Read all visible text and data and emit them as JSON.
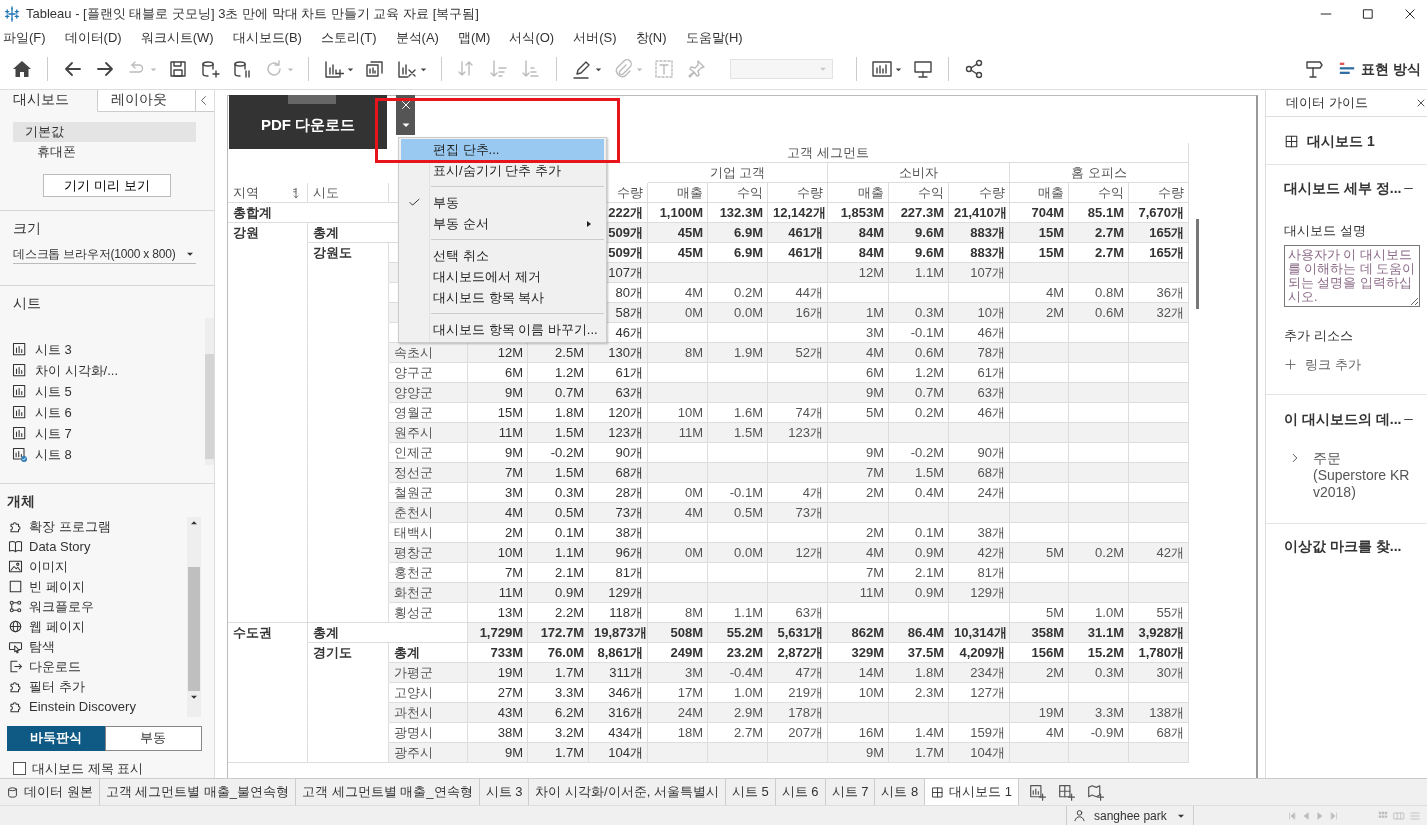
{
  "window": {
    "title": "Tableau - [플랜잇 태블로 굿모닝] 3초 만에 막대 차트 만들기 교육 자료 [복구됨]"
  },
  "menu_bar": [
    "파일(F)",
    "데이터(D)",
    "워크시트(W)",
    "대시보드(B)",
    "스토리(T)",
    "분석(A)",
    "맵(M)",
    "서식(O)",
    "서버(S)",
    "창(N)",
    "도움말(H)"
  ],
  "toolbar": [
    {
      "kind": "home",
      "disabled": false,
      "dropdown": false
    },
    {
      "kind": "separator"
    },
    {
      "kind": "back",
      "disabled": false,
      "dropdown": false
    },
    {
      "kind": "forward",
      "disabled": false,
      "dropdown": false
    },
    {
      "kind": "redo",
      "disabled": true,
      "dropdown": true
    },
    {
      "kind": "save",
      "disabled": false,
      "dropdown": false
    },
    {
      "kind": "db_add",
      "disabled": false,
      "dropdown": false
    },
    {
      "kind": "db_pause",
      "disabled": false,
      "dropdown": false
    },
    {
      "kind": "refresh",
      "disabled": true,
      "dropdown": true
    },
    {
      "kind": "separator"
    },
    {
      "kind": "chart_add",
      "disabled": false,
      "dropdown": true
    },
    {
      "kind": "chart_copy",
      "disabled": false,
      "dropdown": false
    },
    {
      "kind": "chart_clear",
      "disabled": false,
      "dropdown": true
    },
    {
      "kind": "separator"
    },
    {
      "kind": "swap",
      "disabled": true,
      "dropdown": false
    },
    {
      "kind": "sort_asc",
      "disabled": true,
      "dropdown": false
    },
    {
      "kind": "sort_desc",
      "disabled": true,
      "dropdown": false
    },
    {
      "kind": "separator"
    },
    {
      "kind": "pen",
      "disabled": false,
      "dropdown": true
    },
    {
      "kind": "paperclip",
      "disabled": true,
      "dropdown": true
    },
    {
      "kind": "textbox",
      "disabled": true,
      "dropdown": false
    },
    {
      "kind": "pin",
      "disabled": true,
      "dropdown": false
    },
    {
      "kind": "select",
      "disabled": true,
      "dropdown": true
    },
    {
      "kind": "separator"
    },
    {
      "kind": "show_me",
      "disabled": false,
      "dropdown": true
    },
    {
      "kind": "present",
      "disabled": false,
      "dropdown": false
    },
    {
      "kind": "separator"
    },
    {
      "kind": "share",
      "disabled": false,
      "dropdown": false
    }
  ],
  "toolbar_right": {
    "presentation_label": "표현 방식"
  },
  "left_panel": {
    "tabs": [
      {
        "label": "대시보드",
        "selected": true
      },
      {
        "label": "레이아웃",
        "selected": false
      }
    ],
    "devices": [
      {
        "label": "기본값",
        "selected": true
      },
      {
        "label": "휴대폰",
        "selected": false
      }
    ],
    "preview_button": "기기 미리 보기",
    "size_title": "크기",
    "size_value": "데스크톱 브라우저(1000 x 800)",
    "sheets_title": "시트",
    "sheets": [
      {
        "label": "시트 3",
        "used": false
      },
      {
        "label": "차이 시각화/...",
        "used": false
      },
      {
        "label": "시트 5",
        "used": false
      },
      {
        "label": "시트 6",
        "used": false
      },
      {
        "label": "시트 7",
        "used": false
      },
      {
        "label": "시트 8",
        "used": true
      }
    ],
    "objects_title": "개체",
    "objects": [
      {
        "kind": "extension",
        "label": "확장 프로그램"
      },
      {
        "kind": "story",
        "label": "Data Story"
      },
      {
        "kind": "image",
        "label": "이미지"
      },
      {
        "kind": "blank",
        "label": "빈 페이지"
      },
      {
        "kind": "workflow",
        "label": "워크플로우"
      },
      {
        "kind": "web",
        "label": "웹 페이지"
      },
      {
        "kind": "navigation",
        "label": "탐색"
      },
      {
        "kind": "download",
        "label": "다운로드"
      },
      {
        "kind": "filter",
        "label": "필터 추가"
      },
      {
        "kind": "einstein",
        "label": "Einstein Discovery"
      }
    ],
    "layout_modes": [
      {
        "label": "바둑판식",
        "selected": true
      },
      {
        "label": "부동",
        "selected": false
      }
    ],
    "show_title": {
      "label": "대시보드 제목 표시",
      "checked": false
    }
  },
  "dashboard": {
    "pdf_object": {
      "label": "PDF 다운로드"
    },
    "table": {
      "title": "고객 세그먼트",
      "segments": [
        "기업 고객",
        "소비자",
        "홈 오피스"
      ],
      "dimension_columns": [
        {
          "label": "지역",
          "sorted": true
        },
        {
          "label": "시도",
          "sorted": false
        }
      ],
      "measure_columns": [
        "수량",
        "매출",
        "수익",
        "수량",
        "매출",
        "수익",
        "수량",
        "매출",
        "수익",
        "수량"
      ],
      "rows": [
        {
          "kind": "grand_total",
          "region": "총합계",
          "values": {
            "column_6": "222개",
            "column_7": "1,100M",
            "column_8": "132.3M",
            "column_9": "12,142개",
            "column_10": "1,853M",
            "column_11": "227.3M",
            "column_12": "21,410개",
            "column_13": "704M",
            "column_14": "85.1M",
            "column_15": "7,670개"
          }
        },
        {
          "kind": "region_total",
          "region": "강원",
          "sido": "총계",
          "values": {
            "column_6": "509개",
            "column_7": "45M",
            "column_8": "6.9M",
            "column_9": "461개",
            "column_10": "84M",
            "column_11": "9.6M",
            "column_12": "883개",
            "column_13": "15M",
            "column_14": "2.7M",
            "column_15": "165개"
          }
        },
        {
          "kind": "sido_total",
          "sido": "강원도",
          "values": {
            "column_6": "509개",
            "column_7": "45M",
            "column_8": "6.9M",
            "column_9": "461개",
            "column_10": "84M",
            "column_11": "9.6M",
            "column_12": "883개",
            "column_13": "15M",
            "column_14": "2.7M",
            "column_15": "165개"
          }
        },
        {
          "kind": "detail",
          "values": {
            "column_6": "107개",
            "column_10": "12M",
            "column_11": "1.1M",
            "column_12": "107개"
          }
        },
        {
          "kind": "detail",
          "values": {
            "column_6": "80개",
            "column_7": "4M",
            "column_8": "0.2M",
            "column_9": "44개",
            "column_13": "4M",
            "column_14": "0.8M",
            "column_15": "36개"
          }
        },
        {
          "kind": "detail",
          "values": {
            "column_6": "58개",
            "column_7": "0M",
            "column_8": "0.0M",
            "column_9": "16개",
            "column_10": "1M",
            "column_11": "0.3M",
            "column_12": "10개",
            "column_13": "2M",
            "column_14": "0.6M",
            "column_15": "32개"
          }
        },
        {
          "kind": "detail",
          "values": {
            "column_6": "46개",
            "column_10": "3M",
            "column_11": "-0.1M",
            "column_12": "46개"
          }
        },
        {
          "kind": "detail",
          "sigungu": "속초시",
          "values": {
            "column_4": "12M",
            "column_5": "2.5M",
            "column_6": "130개",
            "column_7": "8M",
            "column_8": "1.9M",
            "column_9": "52개",
            "column_10": "4M",
            "column_11": "0.6M",
            "column_12": "78개"
          }
        },
        {
          "kind": "detail",
          "sigungu": "양구군",
          "values": {
            "column_4": "6M",
            "column_5": "1.2M",
            "column_6": "61개",
            "column_10": "6M",
            "column_11": "1.2M",
            "column_12": "61개"
          }
        },
        {
          "kind": "detail",
          "sigungu": "양양군",
          "values": {
            "column_4": "9M",
            "column_5": "0.7M",
            "column_6": "63개",
            "column_10": "9M",
            "column_11": "0.7M",
            "column_12": "63개"
          }
        },
        {
          "kind": "detail",
          "sigungu": "영월군",
          "values": {
            "column_4": "15M",
            "column_5": "1.8M",
            "column_6": "120개",
            "column_7": "10M",
            "column_8": "1.6M",
            "column_9": "74개",
            "column_10": "5M",
            "column_11": "0.2M",
            "column_12": "46개"
          }
        },
        {
          "kind": "detail",
          "sigungu": "원주시",
          "values": {
            "column_4": "11M",
            "column_5": "1.5M",
            "column_6": "123개",
            "column_7": "11M",
            "column_8": "1.5M",
            "column_9": "123개"
          }
        },
        {
          "kind": "detail",
          "sigungu": "인제군",
          "values": {
            "column_4": "9M",
            "column_5": "-0.2M",
            "column_6": "90개",
            "column_10": "9M",
            "column_11": "-0.2M",
            "column_12": "90개"
          }
        },
        {
          "kind": "detail",
          "sigungu": "정선군",
          "values": {
            "column_4": "7M",
            "column_5": "1.5M",
            "column_6": "68개",
            "column_10": "7M",
            "column_11": "1.5M",
            "column_12": "68개"
          }
        },
        {
          "kind": "detail",
          "sigungu": "철원군",
          "values": {
            "column_4": "3M",
            "column_5": "0.3M",
            "column_6": "28개",
            "column_7": "0M",
            "column_8": "-0.1M",
            "column_9": "4개",
            "column_10": "2M",
            "column_11": "0.4M",
            "column_12": "24개"
          }
        },
        {
          "kind": "detail",
          "sigungu": "춘천시",
          "values": {
            "column_4": "4M",
            "column_5": "0.5M",
            "column_6": "73개",
            "column_7": "4M",
            "column_8": "0.5M",
            "column_9": "73개"
          }
        },
        {
          "kind": "detail",
          "sigungu": "태백시",
          "values": {
            "column_4": "2M",
            "column_5": "0.1M",
            "column_6": "38개",
            "column_10": "2M",
            "column_11": "0.1M",
            "column_12": "38개"
          }
        },
        {
          "kind": "detail",
          "sigungu": "평창군",
          "values": {
            "column_4": "10M",
            "column_5": "1.1M",
            "column_6": "96개",
            "column_7": "0M",
            "column_8": "0.0M",
            "column_9": "12개",
            "column_10": "4M",
            "column_11": "0.9M",
            "column_12": "42개",
            "column_13": "5M",
            "column_14": "0.2M",
            "column_15": "42개"
          }
        },
        {
          "kind": "detail",
          "sigungu": "홍천군",
          "values": {
            "column_4": "7M",
            "column_5": "2.1M",
            "column_6": "81개",
            "column_10": "7M",
            "column_11": "2.1M",
            "column_12": "81개"
          }
        },
        {
          "kind": "detail",
          "sigungu": "화천군",
          "values": {
            "column_4": "11M",
            "column_5": "0.9M",
            "column_6": "129개",
            "column_10": "11M",
            "column_11": "0.9M",
            "column_12": "129개"
          }
        },
        {
          "kind": "detail",
          "sigungu": "횡성군",
          "values": {
            "column_4": "13M",
            "column_5": "2.2M",
            "column_6": "118개",
            "column_7": "8M",
            "column_8": "1.1M",
            "column_9": "63개",
            "column_13": "5M",
            "column_14": "1.0M",
            "column_15": "55개"
          }
        },
        {
          "kind": "region_total",
          "region": "수도권",
          "sido": "총계",
          "values": {
            "column_4": "1,729M",
            "column_5": "172.7M",
            "column_6": "19,873개",
            "column_7": "508M",
            "column_8": "55.2M",
            "column_9": "5,631개",
            "column_10": "862M",
            "column_11": "86.4M",
            "column_12": "10,314개",
            "column_13": "358M",
            "column_14": "31.1M",
            "column_15": "3,928개"
          }
        },
        {
          "kind": "sido_total",
          "sido": "경기도",
          "sigungu": "총계",
          "values": {
            "column_4": "733M",
            "column_5": "76.0M",
            "column_6": "8,861개",
            "column_7": "249M",
            "column_8": "23.2M",
            "column_9": "2,872개",
            "column_10": "329M",
            "column_11": "37.5M",
            "column_12": "4,209개",
            "column_13": "156M",
            "column_14": "15.2M",
            "column_15": "1,780개"
          }
        },
        {
          "kind": "detail",
          "sigungu": "가평군",
          "values": {
            "column_4": "19M",
            "column_5": "1.7M",
            "column_6": "311개",
            "column_7": "3M",
            "column_8": "-0.4M",
            "column_9": "47개",
            "column_10": "14M",
            "column_11": "1.8M",
            "column_12": "234개",
            "column_13": "2M",
            "column_14": "0.3M",
            "column_15": "30개"
          }
        },
        {
          "kind": "detail",
          "sigungu": "고양시",
          "values": {
            "column_4": "27M",
            "column_5": "3.3M",
            "column_6": "346개",
            "column_7": "17M",
            "column_8": "1.0M",
            "column_9": "219개",
            "column_10": "10M",
            "column_11": "2.3M",
            "column_12": "127개"
          }
        },
        {
          "kind": "detail",
          "sigungu": "과천시",
          "values": {
            "column_4": "43M",
            "column_5": "6.2M",
            "column_6": "316개",
            "column_7": "24M",
            "column_8": "2.9M",
            "column_9": "178개",
            "column_13": "19M",
            "column_14": "3.3M",
            "column_15": "138개"
          }
        },
        {
          "kind": "detail",
          "sigungu": "광명시",
          "values": {
            "column_4": "38M",
            "column_5": "3.2M",
            "column_6": "434개",
            "column_7": "18M",
            "column_8": "2.7M",
            "column_9": "207개",
            "column_10": "16M",
            "column_11": "1.4M",
            "column_12": "159개",
            "column_13": "4M",
            "column_14": "-0.9M",
            "column_15": "68개"
          }
        },
        {
          "kind": "detail",
          "sigungu": "광주시",
          "values": {
            "column_4": "9M",
            "column_5": "1.7M",
            "column_6": "104개",
            "column_10": "9M",
            "column_11": "1.7M",
            "column_12": "104개"
          }
        }
      ]
    },
    "context_menu": {
      "items": [
        {
          "kind": "item",
          "label": "편집 단추...",
          "checked": false,
          "highlighted": true,
          "submenu": false
        },
        {
          "kind": "item",
          "label": "표시/숨기기 단추 추가",
          "checked": false,
          "highlighted": false,
          "submenu": false
        },
        {
          "kind": "separator"
        },
        {
          "kind": "item",
          "label": "부동",
          "checked": true,
          "highlighted": false,
          "submenu": false
        },
        {
          "kind": "item",
          "label": "부동 순서",
          "checked": false,
          "highlighted": false,
          "submenu": true
        },
        {
          "kind": "separator"
        },
        {
          "kind": "item",
          "label": "선택 취소",
          "checked": false,
          "highlighted": false,
          "submenu": false
        },
        {
          "kind": "item",
          "label": "대시보드에서 제거",
          "checked": false,
          "highlighted": false,
          "submenu": false
        },
        {
          "kind": "item",
          "label": "대시보드 항목 복사",
          "checked": false,
          "highlighted": false,
          "submenu": false
        },
        {
          "kind": "separator"
        },
        {
          "kind": "item",
          "label": "대시보드 항목 이름 바꾸기...",
          "checked": false,
          "highlighted": false,
          "submenu": false
        }
      ]
    }
  },
  "data_guide": {
    "title": "데이터 가이드",
    "dashboard_name": "대시보드 1",
    "details_section": {
      "title": "대시보드 세부 정...",
      "expanded": true,
      "description_label": "대시보드 설명",
      "placeholder": "사용자가 이 대시보드를 이해하는 데 도움이 되는 설명을 입력하십시오.",
      "resources_label": "추가 리소스",
      "add_link": "링크 추가"
    },
    "data_section": {
      "title": "이 대시보드의 데...",
      "expanded": true,
      "sources": [
        {
          "label": "주문 (Superstore KR v2018)",
          "expanded": false
        }
      ]
    },
    "outliers_section": {
      "title": "이상값 마크를 찾..."
    }
  },
  "sheet_tabs": [
    {
      "kind": "datasource",
      "label": "데이터 원본",
      "selected": false
    },
    {
      "kind": "sheet",
      "label": "고객 세그먼트별 매출_불연속형",
      "selected": false
    },
    {
      "kind": "sheet",
      "label": "고객 세그먼트별 매출_연속형",
      "selected": false
    },
    {
      "kind": "sheet",
      "label": "시트 3",
      "selected": false
    },
    {
      "kind": "sheet",
      "label": "차이 시각화/이서준, 서울특별시",
      "selected": false
    },
    {
      "kind": "sheet",
      "label": "시트 5",
      "selected": false
    },
    {
      "kind": "sheet",
      "label": "시트 6",
      "selected": false
    },
    {
      "kind": "sheet",
      "label": "시트 7",
      "selected": false
    },
    {
      "kind": "sheet",
      "label": "시트 8",
      "selected": false
    },
    {
      "kind": "dashboard",
      "label": "대시보드 1",
      "selected": true
    }
  ],
  "status_bar": {
    "user": "sanghee park"
  }
}
